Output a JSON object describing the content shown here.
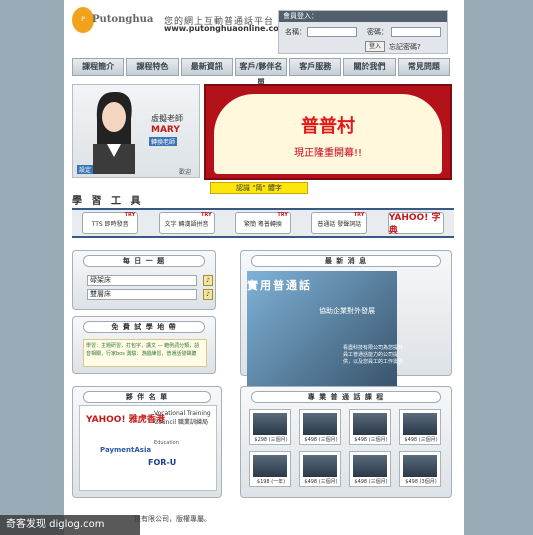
{
  "brand": {
    "logo_name": "Putonghua",
    "slogan": "您的網上互動普通話平台",
    "url": "www.putonghuaonline.com"
  },
  "login": {
    "header": "會員登入：",
    "name_label": "名稱：",
    "password_label": "密碼：",
    "button": "登入",
    "forgot": "忘記密碼?"
  },
  "nav": [
    "課程簡介",
    "課程特色",
    "最新資訊",
    "客戶/夥伴名單",
    "客戶服務",
    "關於我們",
    "常見問題"
  ],
  "teacher": {
    "name": "虛擬老師",
    "english": "MARY",
    "badge": "轉換老師",
    "btn_left": "設定",
    "btn_right": "歡迎"
  },
  "banner": {
    "title": "普普村",
    "subtitle": "現正隆重開幕!!"
  },
  "recognize": "認識 \"简\" 體字",
  "tools": {
    "title": "學 習 工 具",
    "items": [
      {
        "label": "TTS 即時發音",
        "try": "TRY"
      },
      {
        "label": "文字 轉漢語拼音",
        "try": "TRY"
      },
      {
        "label": "繁簡 粵普轉換",
        "try": "TRY"
      },
      {
        "label": "普通話 發聲詞話",
        "try": "TRY"
      },
      {
        "label": "YAHOO! 字典",
        "try": ""
      }
    ]
  },
  "daily": {
    "title": "每 日 一 题",
    "row1": "碌架床",
    "row2": "雙層床"
  },
  "trial": {
    "title": "免 費 試 學 地 帶",
    "text": "學習：主題研習，打包字，講文 — 範例詞分類，語音相關，行家bos 測驗：游戲練習，普通話發聲聽"
  },
  "news": {
    "title": "最 新 消 息",
    "heading": "實用普通話",
    "subtitle": "協助企業對外發展",
    "body": "看盡科技有限公司為您提升員工普通話能力的公司提供，以及您員工的工作需要"
  },
  "partners": {
    "title": "夥 伴 名 單",
    "names": [
      "YAHOO! 雅虎香港",
      "Vocational Training Council 職業訓練局",
      "PaymentAsia",
      "FOR-U",
      "Education"
    ]
  },
  "courses": {
    "title": "專 業 普 通 話 課 程",
    "prices": [
      "$298 (三個月)",
      "$498 (三個月)",
      "$498 (三個月)",
      "$498 (三個月)",
      "$198 (一年)",
      "$498 (三個月)",
      "$498 (三個月)",
      "$498 (3個月)"
    ]
  },
  "footer": "技有限公司，版權專屬。",
  "watermark": "奇客发现 diglog.com"
}
